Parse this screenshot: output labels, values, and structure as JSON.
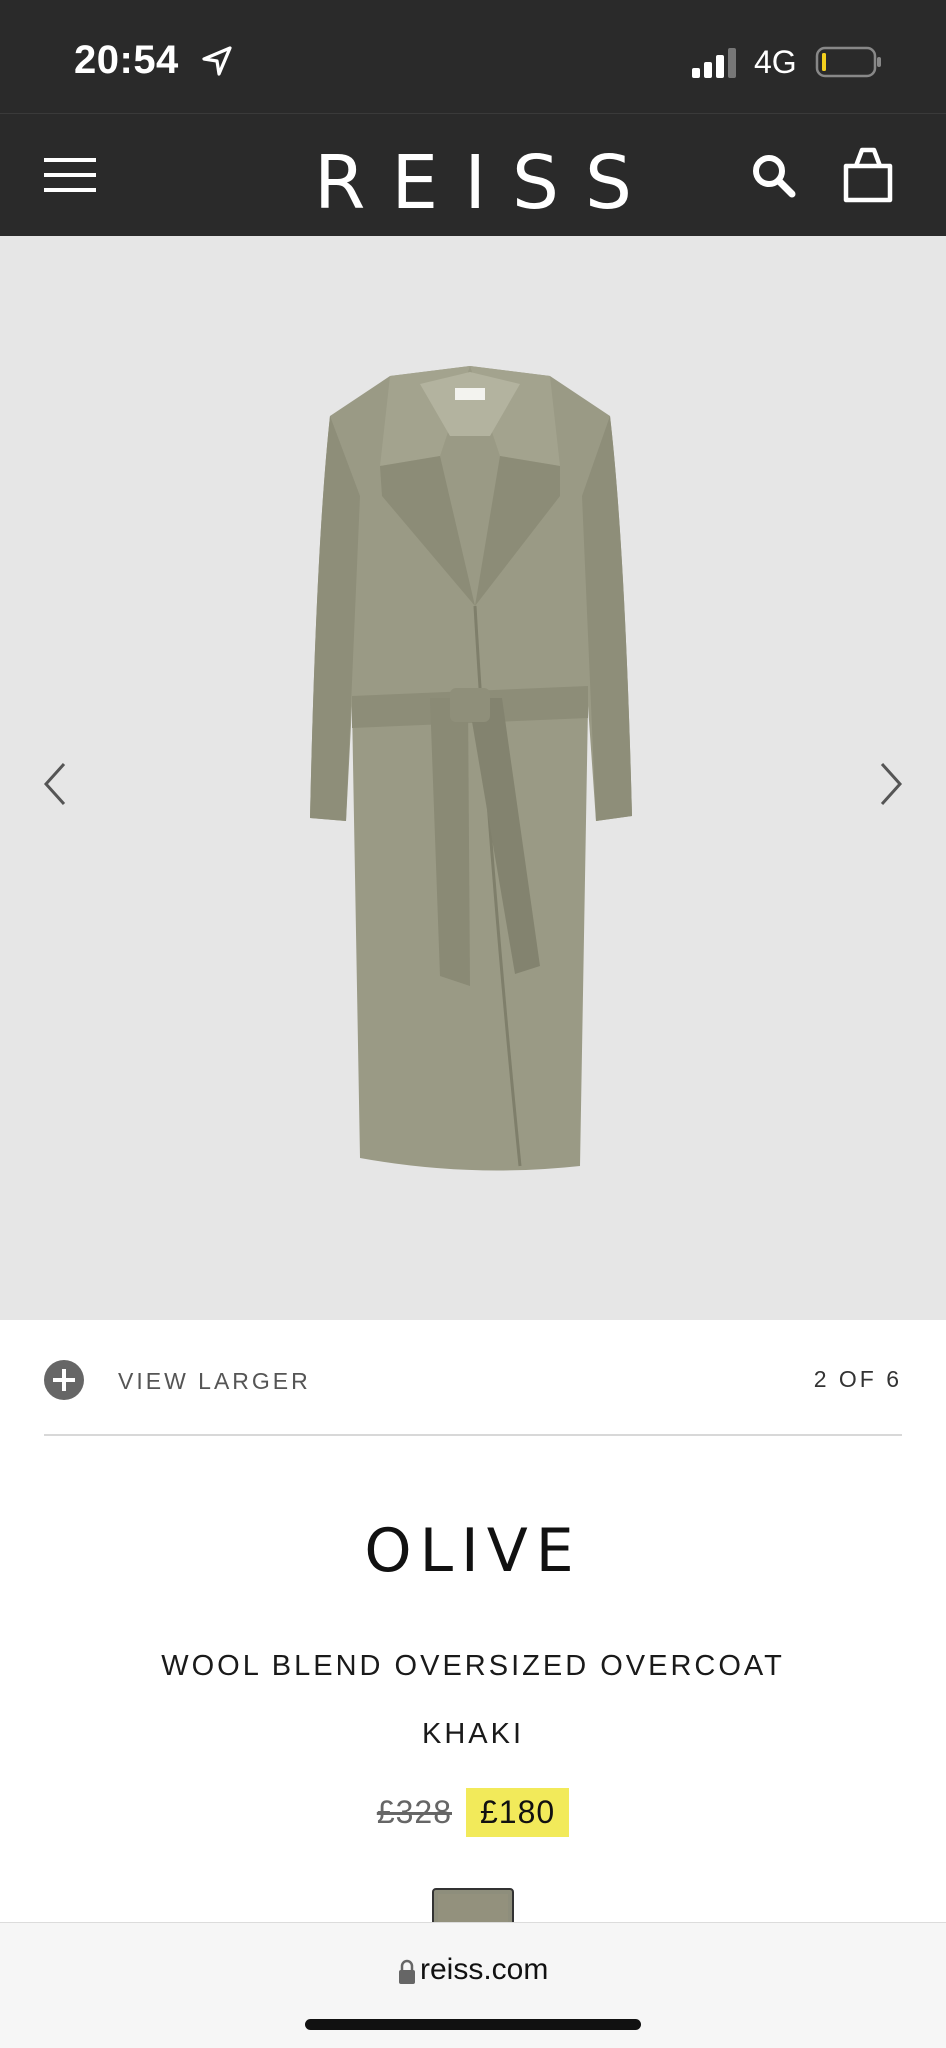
{
  "status_bar": {
    "time": "20:54",
    "network": "4G",
    "icons": [
      "location-arrow-icon",
      "signal-icon",
      "battery-icon"
    ]
  },
  "header": {
    "logo": "REISS",
    "icons": [
      "menu-icon",
      "search-icon",
      "bag-icon"
    ]
  },
  "gallery": {
    "view_larger_label": "VIEW LARGER",
    "counter": "2 OF 6",
    "image_bg": "#e6e6e6"
  },
  "product": {
    "brand": "OLIVE",
    "name": "WOOL BLEND OVERSIZED OVERCOAT",
    "color": "KHAKI",
    "old_price": "£328",
    "price": "£180",
    "price_highlight_color": "#f2ea5a"
  },
  "browser": {
    "url": "reiss.com"
  }
}
